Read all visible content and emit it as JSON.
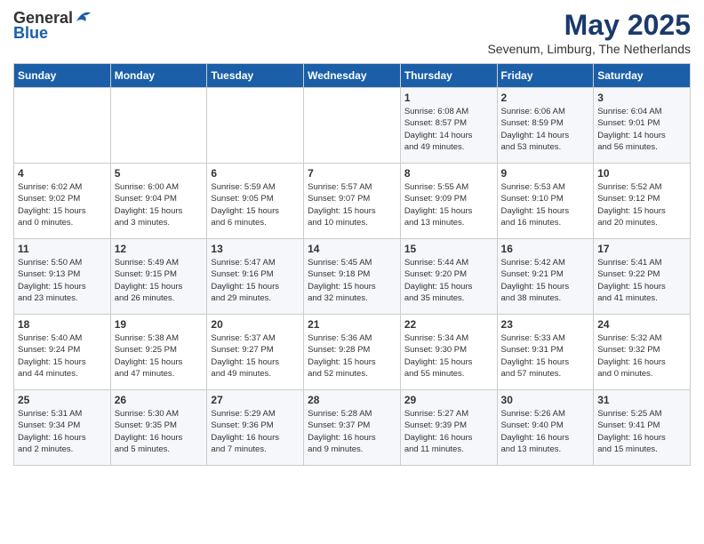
{
  "header": {
    "logo_general": "General",
    "logo_blue": "Blue",
    "month_title": "May 2025",
    "subtitle": "Sevenum, Limburg, The Netherlands"
  },
  "days_of_week": [
    "Sunday",
    "Monday",
    "Tuesday",
    "Wednesday",
    "Thursday",
    "Friday",
    "Saturday"
  ],
  "weeks": [
    [
      {
        "day": "",
        "info": ""
      },
      {
        "day": "",
        "info": ""
      },
      {
        "day": "",
        "info": ""
      },
      {
        "day": "",
        "info": ""
      },
      {
        "day": "1",
        "info": "Sunrise: 6:08 AM\nSunset: 8:57 PM\nDaylight: 14 hours\nand 49 minutes."
      },
      {
        "day": "2",
        "info": "Sunrise: 6:06 AM\nSunset: 8:59 PM\nDaylight: 14 hours\nand 53 minutes."
      },
      {
        "day": "3",
        "info": "Sunrise: 6:04 AM\nSunset: 9:01 PM\nDaylight: 14 hours\nand 56 minutes."
      }
    ],
    [
      {
        "day": "4",
        "info": "Sunrise: 6:02 AM\nSunset: 9:02 PM\nDaylight: 15 hours\nand 0 minutes."
      },
      {
        "day": "5",
        "info": "Sunrise: 6:00 AM\nSunset: 9:04 PM\nDaylight: 15 hours\nand 3 minutes."
      },
      {
        "day": "6",
        "info": "Sunrise: 5:59 AM\nSunset: 9:05 PM\nDaylight: 15 hours\nand 6 minutes."
      },
      {
        "day": "7",
        "info": "Sunrise: 5:57 AM\nSunset: 9:07 PM\nDaylight: 15 hours\nand 10 minutes."
      },
      {
        "day": "8",
        "info": "Sunrise: 5:55 AM\nSunset: 9:09 PM\nDaylight: 15 hours\nand 13 minutes."
      },
      {
        "day": "9",
        "info": "Sunrise: 5:53 AM\nSunset: 9:10 PM\nDaylight: 15 hours\nand 16 minutes."
      },
      {
        "day": "10",
        "info": "Sunrise: 5:52 AM\nSunset: 9:12 PM\nDaylight: 15 hours\nand 20 minutes."
      }
    ],
    [
      {
        "day": "11",
        "info": "Sunrise: 5:50 AM\nSunset: 9:13 PM\nDaylight: 15 hours\nand 23 minutes."
      },
      {
        "day": "12",
        "info": "Sunrise: 5:49 AM\nSunset: 9:15 PM\nDaylight: 15 hours\nand 26 minutes."
      },
      {
        "day": "13",
        "info": "Sunrise: 5:47 AM\nSunset: 9:16 PM\nDaylight: 15 hours\nand 29 minutes."
      },
      {
        "day": "14",
        "info": "Sunrise: 5:45 AM\nSunset: 9:18 PM\nDaylight: 15 hours\nand 32 minutes."
      },
      {
        "day": "15",
        "info": "Sunrise: 5:44 AM\nSunset: 9:20 PM\nDaylight: 15 hours\nand 35 minutes."
      },
      {
        "day": "16",
        "info": "Sunrise: 5:42 AM\nSunset: 9:21 PM\nDaylight: 15 hours\nand 38 minutes."
      },
      {
        "day": "17",
        "info": "Sunrise: 5:41 AM\nSunset: 9:22 PM\nDaylight: 15 hours\nand 41 minutes."
      }
    ],
    [
      {
        "day": "18",
        "info": "Sunrise: 5:40 AM\nSunset: 9:24 PM\nDaylight: 15 hours\nand 44 minutes."
      },
      {
        "day": "19",
        "info": "Sunrise: 5:38 AM\nSunset: 9:25 PM\nDaylight: 15 hours\nand 47 minutes."
      },
      {
        "day": "20",
        "info": "Sunrise: 5:37 AM\nSunset: 9:27 PM\nDaylight: 15 hours\nand 49 minutes."
      },
      {
        "day": "21",
        "info": "Sunrise: 5:36 AM\nSunset: 9:28 PM\nDaylight: 15 hours\nand 52 minutes."
      },
      {
        "day": "22",
        "info": "Sunrise: 5:34 AM\nSunset: 9:30 PM\nDaylight: 15 hours\nand 55 minutes."
      },
      {
        "day": "23",
        "info": "Sunrise: 5:33 AM\nSunset: 9:31 PM\nDaylight: 15 hours\nand 57 minutes."
      },
      {
        "day": "24",
        "info": "Sunrise: 5:32 AM\nSunset: 9:32 PM\nDaylight: 16 hours\nand 0 minutes."
      }
    ],
    [
      {
        "day": "25",
        "info": "Sunrise: 5:31 AM\nSunset: 9:34 PM\nDaylight: 16 hours\nand 2 minutes."
      },
      {
        "day": "26",
        "info": "Sunrise: 5:30 AM\nSunset: 9:35 PM\nDaylight: 16 hours\nand 5 minutes."
      },
      {
        "day": "27",
        "info": "Sunrise: 5:29 AM\nSunset: 9:36 PM\nDaylight: 16 hours\nand 7 minutes."
      },
      {
        "day": "28",
        "info": "Sunrise: 5:28 AM\nSunset: 9:37 PM\nDaylight: 16 hours\nand 9 minutes."
      },
      {
        "day": "29",
        "info": "Sunrise: 5:27 AM\nSunset: 9:39 PM\nDaylight: 16 hours\nand 11 minutes."
      },
      {
        "day": "30",
        "info": "Sunrise: 5:26 AM\nSunset: 9:40 PM\nDaylight: 16 hours\nand 13 minutes."
      },
      {
        "day": "31",
        "info": "Sunrise: 5:25 AM\nSunset: 9:41 PM\nDaylight: 16 hours\nand 15 minutes."
      }
    ]
  ]
}
